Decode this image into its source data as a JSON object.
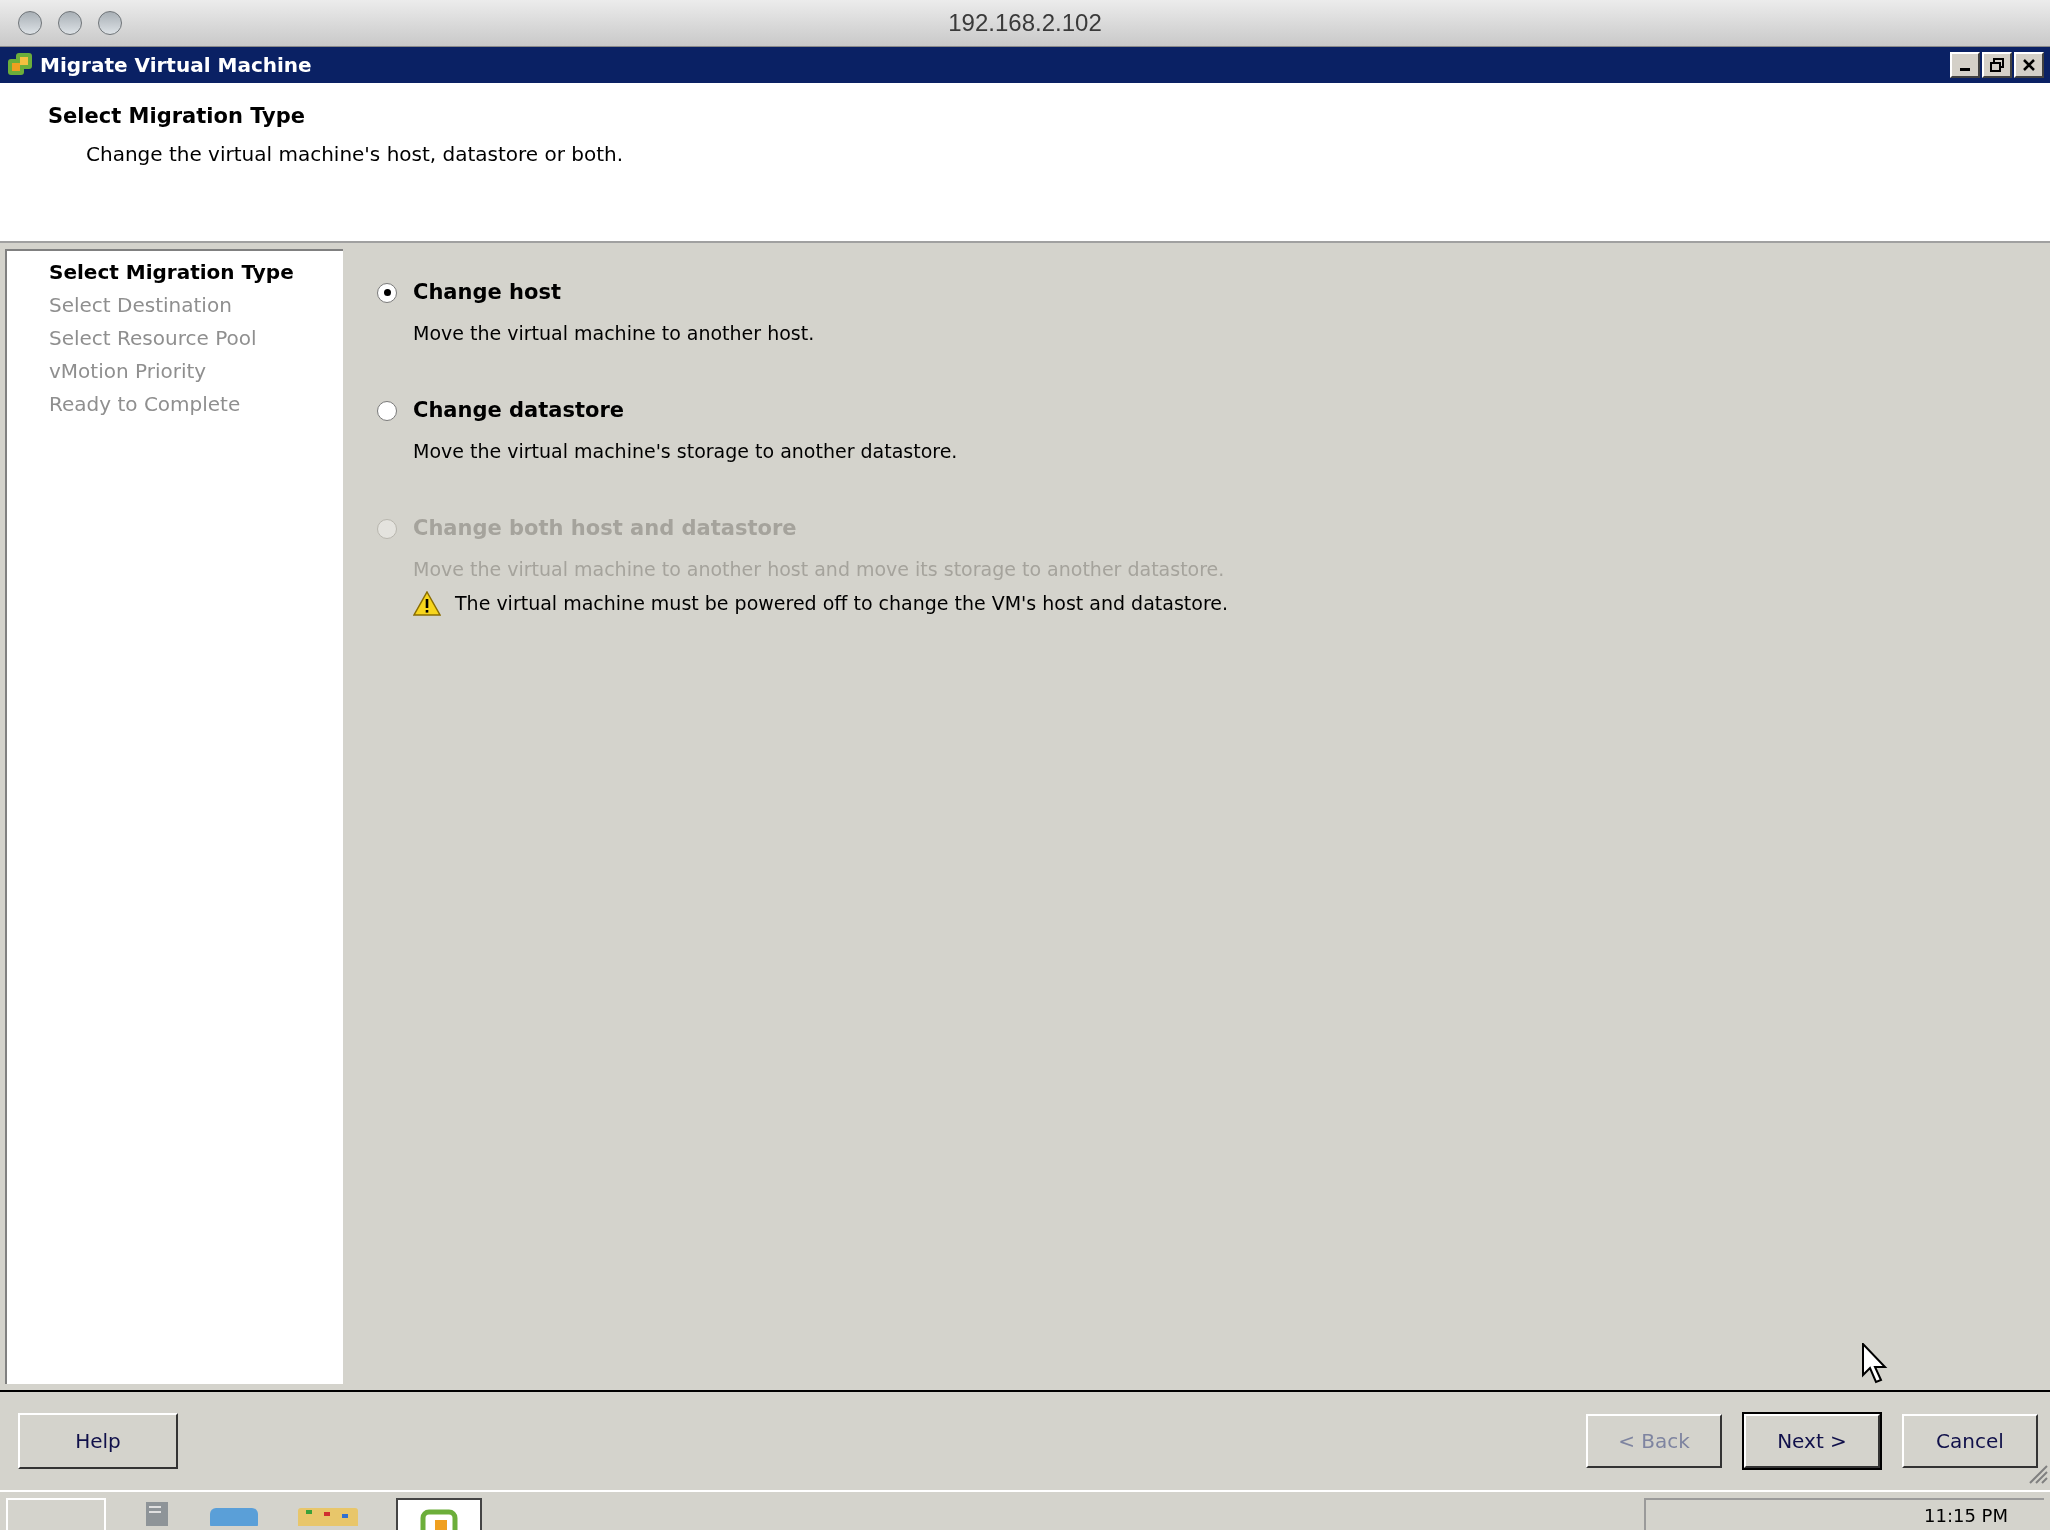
{
  "mac_window": {
    "title": "192.168.2.102"
  },
  "dialog": {
    "title": "Migrate Virtual Machine"
  },
  "header": {
    "title": "Select Migration Type",
    "subtitle": "Change the virtual machine's host, datastore or both."
  },
  "steps": [
    {
      "label": "Select Migration Type",
      "selected": true
    },
    {
      "label": "Select Destination",
      "selected": false
    },
    {
      "label": "Select Resource Pool",
      "selected": false
    },
    {
      "label": "vMotion Priority",
      "selected": false
    },
    {
      "label": "Ready to Complete",
      "selected": false
    }
  ],
  "options": [
    {
      "label": "Change host",
      "description": "Move the virtual machine to another host.",
      "selected": true,
      "disabled": false
    },
    {
      "label": "Change datastore",
      "description": "Move the virtual machine's storage to another datastore.",
      "selected": false,
      "disabled": false
    },
    {
      "label": "Change both host and datastore",
      "description": "Move the virtual machine to another host and move its storage to another datastore.",
      "selected": false,
      "disabled": true,
      "warning": "The virtual machine must be powered off to change the VM's host and datastore."
    }
  ],
  "help_button": {
    "label": "Help"
  },
  "nav_buttons": [
    {
      "label": "< Back",
      "disabled": true,
      "default": false
    },
    {
      "label": "Next >",
      "disabled": false,
      "default": true
    },
    {
      "label": "Cancel",
      "disabled": false,
      "default": false
    }
  ],
  "taskbar": {
    "clock": "11:15 PM"
  }
}
